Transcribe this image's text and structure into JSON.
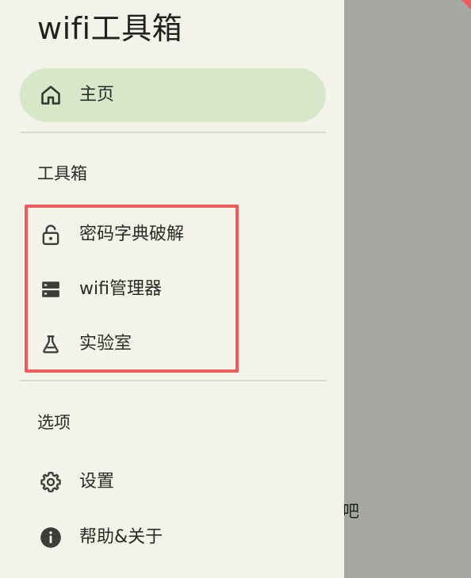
{
  "drawer": {
    "title": "wifi工具箱",
    "home": {
      "label": "主页",
      "icon": "home-icon"
    },
    "sections": {
      "tools": {
        "title": "工具箱",
        "items": [
          {
            "label": "密码字典破解",
            "icon": "lock-open-icon"
          },
          {
            "label": "wifi管理器",
            "icon": "storage-icon"
          },
          {
            "label": "实验室",
            "icon": "flask-icon"
          }
        ]
      },
      "options": {
        "title": "选项",
        "items": [
          {
            "label": "设置",
            "icon": "gear-icon"
          },
          {
            "label": "帮助&关于",
            "icon": "info-icon"
          }
        ]
      }
    }
  },
  "background": {
    "peek_text": "吧"
  },
  "colors": {
    "drawer_bg": "#f3f3ea",
    "selected_bg": "#d7e7c9",
    "scrim": "#a5a8a2",
    "highlight_border": "#ef5b5b",
    "icon": "#3b3d38"
  }
}
